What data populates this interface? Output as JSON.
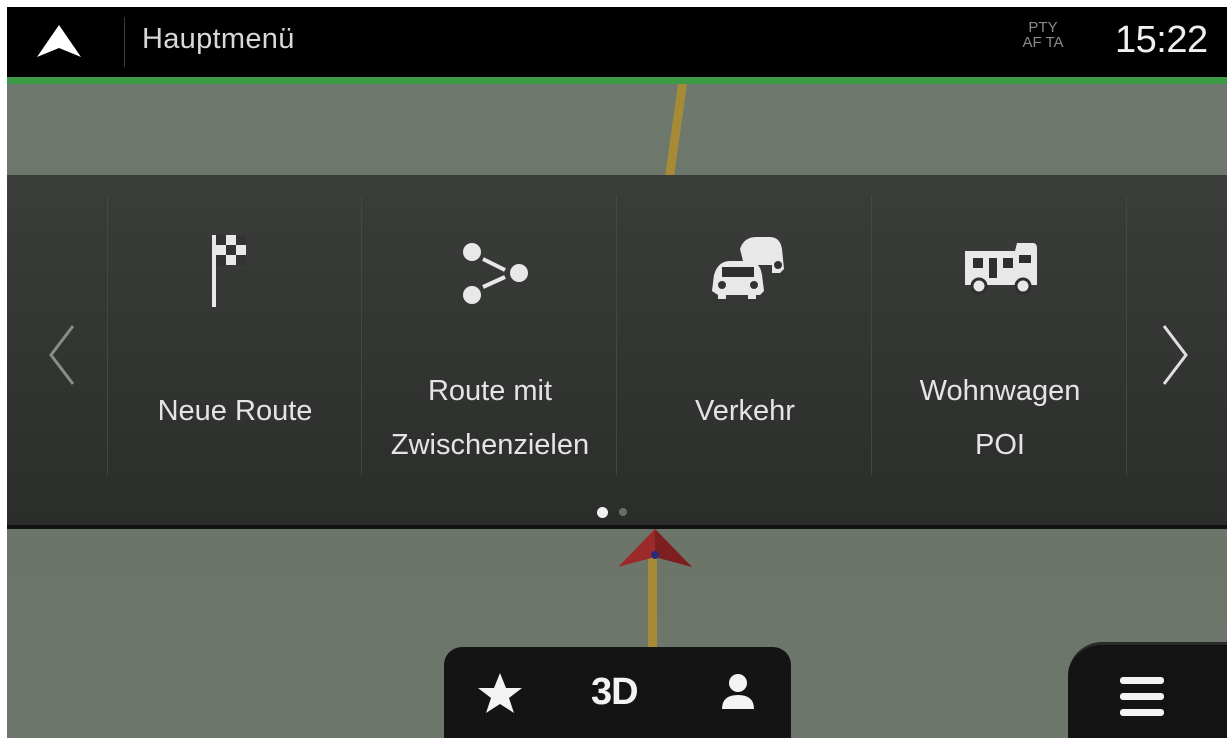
{
  "header": {
    "title": "Hauptmenü",
    "rds_line1": "PTY",
    "rds_line2": "AF TA",
    "clock": "15:22"
  },
  "menu": {
    "tiles": [
      {
        "label_line1": "Neue Route",
        "label_line2": "",
        "icon": "checkered-flag-icon"
      },
      {
        "label_line1": "Route mit",
        "label_line2": "Zwischenzielen",
        "icon": "waypoints-icon"
      },
      {
        "label_line1": "Verkehr",
        "label_line2": "",
        "icon": "traffic-cars-icon"
      },
      {
        "label_line1": "Wohnwagen",
        "label_line2": "POI",
        "icon": "camper-van-icon"
      }
    ],
    "pages_total": 2,
    "page_current": 1
  },
  "bottom_bar": {
    "favorites_icon": "star-icon",
    "view_mode_label": "3D",
    "user_icon": "person-icon"
  },
  "colors": {
    "accent_green": "#3d9a46",
    "route_line": "#a68a35",
    "position_marker": "#9c2a2a"
  }
}
